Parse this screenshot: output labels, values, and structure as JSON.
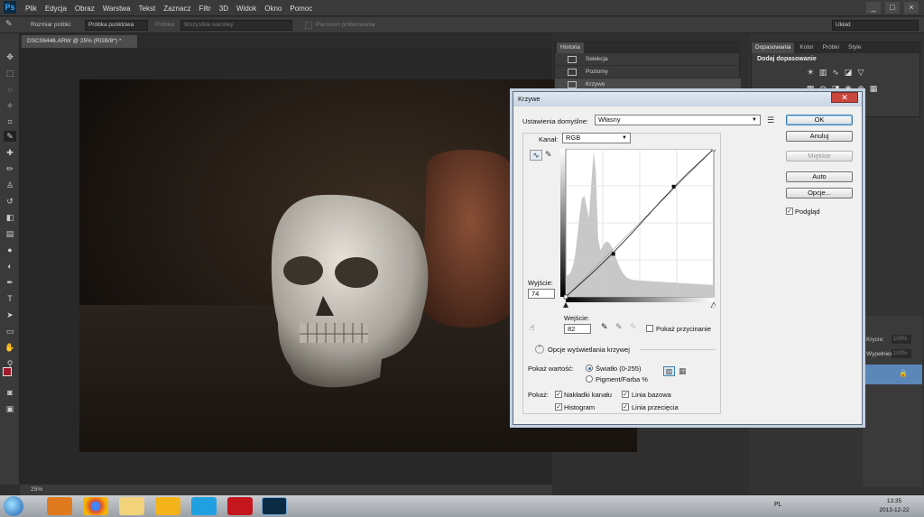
{
  "app": {
    "logo": "Ps"
  },
  "menu": [
    "Plik",
    "Edycja",
    "Obraz",
    "Warstwa",
    "Tekst",
    "Zaznacz",
    "Filtr",
    "3D",
    "Widok",
    "Okno",
    "Pomoc"
  ],
  "window_controls": [
    "_",
    "□",
    "×"
  ],
  "options_bar": {
    "sample_size_label": "Rozmiar próbki:",
    "sample_size_value": "Próbka punktowa",
    "sample_label": "Próbka:",
    "sample_value": "Wszystkie warstwy",
    "show_ring_label": "Pierścień próbkowania",
    "workspace_value": "Układ"
  },
  "document": {
    "tab_title": "DSC06446.ARW @ 25% (RGB/8*) *",
    "zoom": "25%"
  },
  "history": {
    "tab": "Historia",
    "items": [
      "Selekcja",
      "Poziomy",
      "Krzywe"
    ]
  },
  "adjustments": {
    "tabs": [
      "Dopasowania",
      "Kolor",
      "Próbki",
      "Style"
    ],
    "title": "Dodaj dopasowanie"
  },
  "layers": {
    "opacity_label": "Krycie:",
    "opacity_value": "100%",
    "fill_label": "Wypełnienie:",
    "fill_value": "100%"
  },
  "dialog": {
    "title": "Krzywe",
    "preset_label": "Ustawienia domyślne:",
    "preset_value": "Własny",
    "channel_label": "Kanał:",
    "channel_value": "RGB",
    "output_label": "Wyjście:",
    "output_value": "74",
    "input_label": "Wejście:",
    "input_value": "82",
    "show_clipping_label": "Pokaż przycinanie",
    "curve_display_options_label": "Opcje wyświetlania krzywej",
    "show_amount_label": "Pokaż wartość:",
    "light_option": "Światło (0-255)",
    "pigment_option": "Pigment/Farba %",
    "show_label": "Pokaż:",
    "channel_overlays_label": "Nakładki kanału",
    "baseline_label": "Linia bazowa",
    "histogram_label": "Histogram",
    "intersection_label": "Linia przecięcia",
    "buttons": {
      "ok": "OK",
      "cancel": "Anuluj",
      "smooth": "Miękkie",
      "auto": "Auto",
      "options": "Opcje..."
    },
    "preview_label": "Podgląd",
    "input_level": 82,
    "output_level": 74
  },
  "taskbar": {
    "time": "13:35",
    "date": "2013-12-22",
    "lang": "PL"
  },
  "colors": {
    "foreground": "#a01a2a",
    "background": "#ffffff",
    "selection": "#5a86b8"
  }
}
